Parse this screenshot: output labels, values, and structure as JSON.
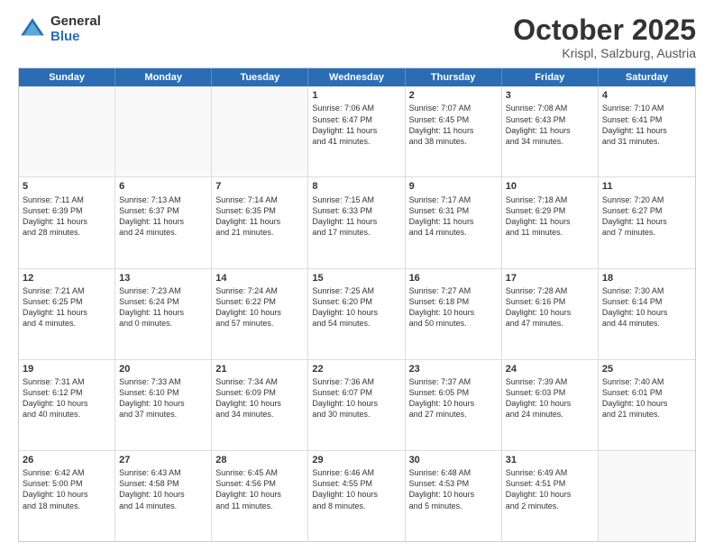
{
  "logo": {
    "general": "General",
    "blue": "Blue"
  },
  "header": {
    "month": "October 2025",
    "location": "Krispl, Salzburg, Austria"
  },
  "days": [
    "Sunday",
    "Monday",
    "Tuesday",
    "Wednesday",
    "Thursday",
    "Friday",
    "Saturday"
  ],
  "weeks": [
    [
      {
        "day": "",
        "empty": true
      },
      {
        "day": "",
        "empty": true
      },
      {
        "day": "",
        "empty": true
      },
      {
        "day": "1",
        "lines": [
          "Sunrise: 7:06 AM",
          "Sunset: 6:47 PM",
          "Daylight: 11 hours",
          "and 41 minutes."
        ]
      },
      {
        "day": "2",
        "lines": [
          "Sunrise: 7:07 AM",
          "Sunset: 6:45 PM",
          "Daylight: 11 hours",
          "and 38 minutes."
        ]
      },
      {
        "day": "3",
        "lines": [
          "Sunrise: 7:08 AM",
          "Sunset: 6:43 PM",
          "Daylight: 11 hours",
          "and 34 minutes."
        ]
      },
      {
        "day": "4",
        "lines": [
          "Sunrise: 7:10 AM",
          "Sunset: 6:41 PM",
          "Daylight: 11 hours",
          "and 31 minutes."
        ]
      }
    ],
    [
      {
        "day": "5",
        "lines": [
          "Sunrise: 7:11 AM",
          "Sunset: 6:39 PM",
          "Daylight: 11 hours",
          "and 28 minutes."
        ]
      },
      {
        "day": "6",
        "lines": [
          "Sunrise: 7:13 AM",
          "Sunset: 6:37 PM",
          "Daylight: 11 hours",
          "and 24 minutes."
        ]
      },
      {
        "day": "7",
        "lines": [
          "Sunrise: 7:14 AM",
          "Sunset: 6:35 PM",
          "Daylight: 11 hours",
          "and 21 minutes."
        ]
      },
      {
        "day": "8",
        "lines": [
          "Sunrise: 7:15 AM",
          "Sunset: 6:33 PM",
          "Daylight: 11 hours",
          "and 17 minutes."
        ]
      },
      {
        "day": "9",
        "lines": [
          "Sunrise: 7:17 AM",
          "Sunset: 6:31 PM",
          "Daylight: 11 hours",
          "and 14 minutes."
        ]
      },
      {
        "day": "10",
        "lines": [
          "Sunrise: 7:18 AM",
          "Sunset: 6:29 PM",
          "Daylight: 11 hours",
          "and 11 minutes."
        ]
      },
      {
        "day": "11",
        "lines": [
          "Sunrise: 7:20 AM",
          "Sunset: 6:27 PM",
          "Daylight: 11 hours",
          "and 7 minutes."
        ]
      }
    ],
    [
      {
        "day": "12",
        "lines": [
          "Sunrise: 7:21 AM",
          "Sunset: 6:25 PM",
          "Daylight: 11 hours",
          "and 4 minutes."
        ]
      },
      {
        "day": "13",
        "lines": [
          "Sunrise: 7:23 AM",
          "Sunset: 6:24 PM",
          "Daylight: 11 hours",
          "and 0 minutes."
        ]
      },
      {
        "day": "14",
        "lines": [
          "Sunrise: 7:24 AM",
          "Sunset: 6:22 PM",
          "Daylight: 10 hours",
          "and 57 minutes."
        ]
      },
      {
        "day": "15",
        "lines": [
          "Sunrise: 7:25 AM",
          "Sunset: 6:20 PM",
          "Daylight: 10 hours",
          "and 54 minutes."
        ]
      },
      {
        "day": "16",
        "lines": [
          "Sunrise: 7:27 AM",
          "Sunset: 6:18 PM",
          "Daylight: 10 hours",
          "and 50 minutes."
        ]
      },
      {
        "day": "17",
        "lines": [
          "Sunrise: 7:28 AM",
          "Sunset: 6:16 PM",
          "Daylight: 10 hours",
          "and 47 minutes."
        ]
      },
      {
        "day": "18",
        "lines": [
          "Sunrise: 7:30 AM",
          "Sunset: 6:14 PM",
          "Daylight: 10 hours",
          "and 44 minutes."
        ]
      }
    ],
    [
      {
        "day": "19",
        "lines": [
          "Sunrise: 7:31 AM",
          "Sunset: 6:12 PM",
          "Daylight: 10 hours",
          "and 40 minutes."
        ]
      },
      {
        "day": "20",
        "lines": [
          "Sunrise: 7:33 AM",
          "Sunset: 6:10 PM",
          "Daylight: 10 hours",
          "and 37 minutes."
        ]
      },
      {
        "day": "21",
        "lines": [
          "Sunrise: 7:34 AM",
          "Sunset: 6:09 PM",
          "Daylight: 10 hours",
          "and 34 minutes."
        ]
      },
      {
        "day": "22",
        "lines": [
          "Sunrise: 7:36 AM",
          "Sunset: 6:07 PM",
          "Daylight: 10 hours",
          "and 30 minutes."
        ]
      },
      {
        "day": "23",
        "lines": [
          "Sunrise: 7:37 AM",
          "Sunset: 6:05 PM",
          "Daylight: 10 hours",
          "and 27 minutes."
        ]
      },
      {
        "day": "24",
        "lines": [
          "Sunrise: 7:39 AM",
          "Sunset: 6:03 PM",
          "Daylight: 10 hours",
          "and 24 minutes."
        ]
      },
      {
        "day": "25",
        "lines": [
          "Sunrise: 7:40 AM",
          "Sunset: 6:01 PM",
          "Daylight: 10 hours",
          "and 21 minutes."
        ]
      }
    ],
    [
      {
        "day": "26",
        "lines": [
          "Sunrise: 6:42 AM",
          "Sunset: 5:00 PM",
          "Daylight: 10 hours",
          "and 18 minutes."
        ]
      },
      {
        "day": "27",
        "lines": [
          "Sunrise: 6:43 AM",
          "Sunset: 4:58 PM",
          "Daylight: 10 hours",
          "and 14 minutes."
        ]
      },
      {
        "day": "28",
        "lines": [
          "Sunrise: 6:45 AM",
          "Sunset: 4:56 PM",
          "Daylight: 10 hours",
          "and 11 minutes."
        ]
      },
      {
        "day": "29",
        "lines": [
          "Sunrise: 6:46 AM",
          "Sunset: 4:55 PM",
          "Daylight: 10 hours",
          "and 8 minutes."
        ]
      },
      {
        "day": "30",
        "lines": [
          "Sunrise: 6:48 AM",
          "Sunset: 4:53 PM",
          "Daylight: 10 hours",
          "and 5 minutes."
        ]
      },
      {
        "day": "31",
        "lines": [
          "Sunrise: 6:49 AM",
          "Sunset: 4:51 PM",
          "Daylight: 10 hours",
          "and 2 minutes."
        ]
      },
      {
        "day": "",
        "empty": true,
        "shaded": true
      }
    ]
  ]
}
